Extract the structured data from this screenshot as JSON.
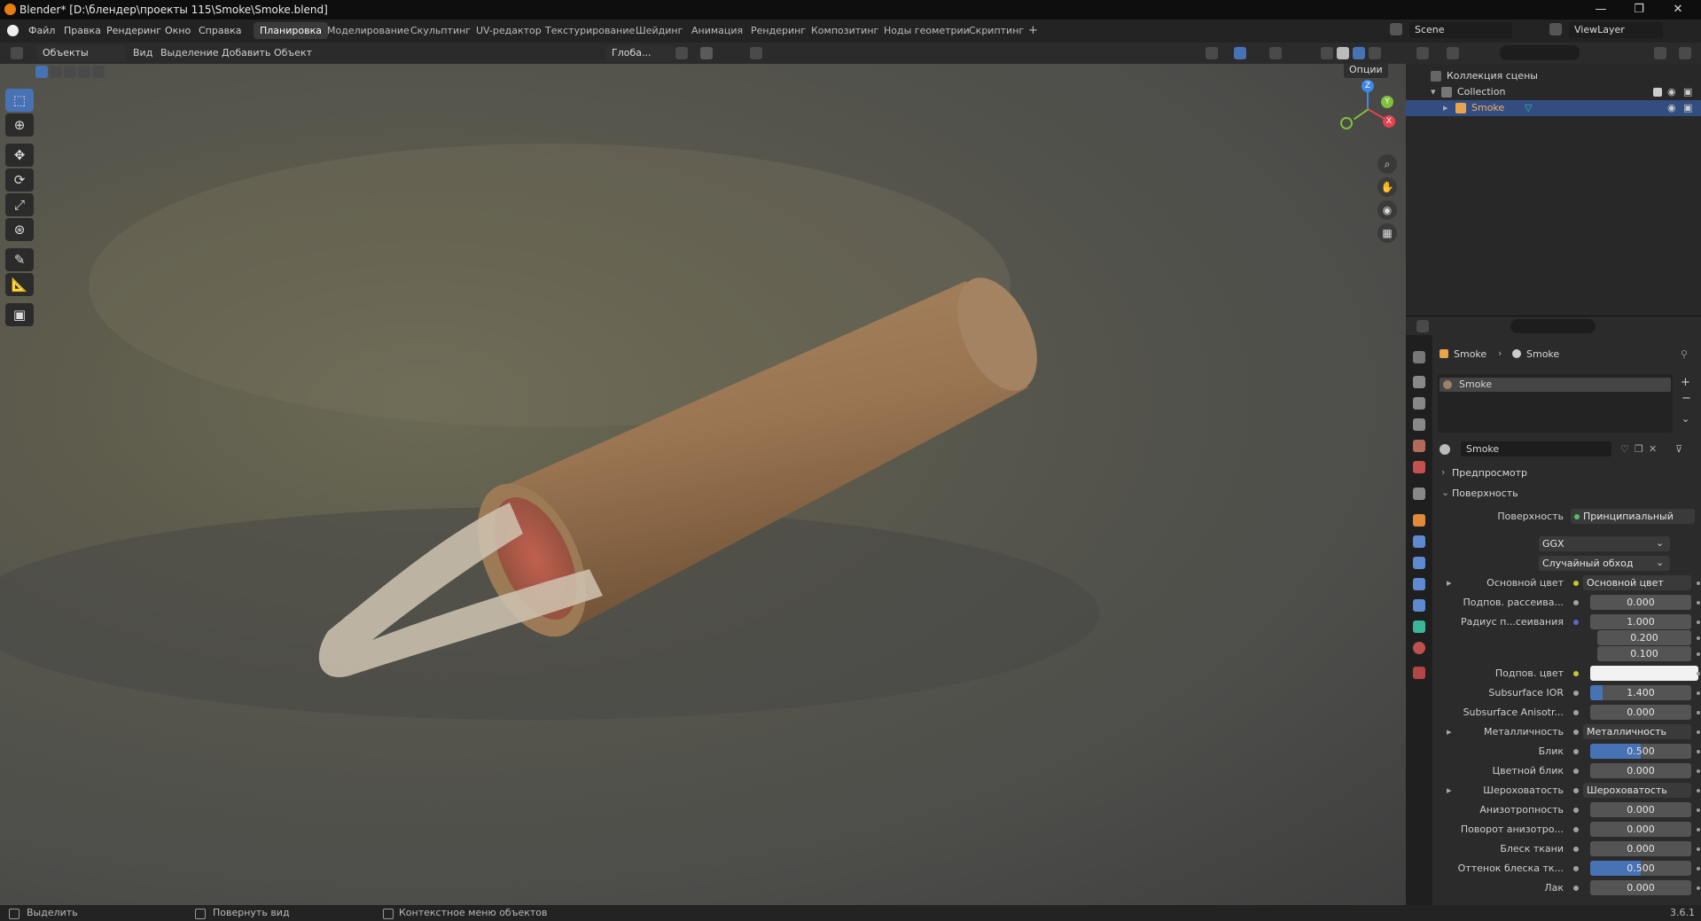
{
  "window": {
    "title": "Blender* [D:\\блендер\\проекты 115\\Smoke\\Smoke.blend]",
    "min": "—",
    "max": "❐",
    "close": "✕"
  },
  "menu": [
    "Файл",
    "Правка",
    "Рендеринг",
    "Окно",
    "Справка"
  ],
  "workspaces": [
    "Планировка",
    "Моделирование",
    "Скульптинг",
    "UV-редактор",
    "Текстурирование",
    "Шейдинг",
    "Анимация",
    "Рендеринг",
    "Композитинг",
    "Ноды геометрии",
    "Скриптинг"
  ],
  "workspace_add": "+",
  "scene": {
    "name": "Scene",
    "view_layer": "ViewLayer"
  },
  "viewport_header": {
    "mode": "Объекты",
    "menus": [
      "Вид",
      "Выделение",
      "Добавить",
      "Объект"
    ],
    "transform": "Глоба...",
    "options": "Опции"
  },
  "outliner": {
    "scene_collection": "Коллекция сцены",
    "collection": "Collection",
    "object": "Smoke"
  },
  "properties": {
    "breadcrumb_object": "Smoke",
    "breadcrumb_material": "Smoke",
    "slot": "Smoke",
    "material_name": "Smoke",
    "sections": {
      "preview": "Предпросмотр",
      "surface": "Поверхность"
    },
    "surface_label": "Поверхность",
    "surface_value": "Принципиальный BSDF",
    "distribution": "GGX",
    "subsurface_method": "Случайный обход",
    "rows": [
      {
        "label": "Основной цвет",
        "value": "Основной цвет",
        "kind": "link",
        "dot": "#c7c729",
        "expand": true
      },
      {
        "label": "Подпов. рассеива...",
        "value": "0.000",
        "kind": "num",
        "dot": "#a1a1a1",
        "fill": 0
      },
      {
        "label": "Радиус п...сеивания",
        "value": "1.000",
        "kind": "num",
        "dot": "#6363c7",
        "fill": 0
      },
      {
        "label": "",
        "value": "0.200",
        "kind": "num",
        "fill": 0
      },
      {
        "label": "",
        "value": "0.100",
        "kind": "num",
        "fill": 0
      },
      {
        "label": "Подпов. цвет",
        "value": "",
        "kind": "color",
        "dot": "#c7c729"
      },
      {
        "label": "Subsurface IOR",
        "value": "1.400",
        "kind": "num",
        "dot": "#a1a1a1",
        "fill": 0.12
      },
      {
        "label": "Subsurface Anisotr...",
        "value": "0.000",
        "kind": "num",
        "dot": "#a1a1a1",
        "fill": 0
      },
      {
        "label": "Металличность",
        "value": "Металличность",
        "kind": "link",
        "dot": "#a1a1a1",
        "expand": true
      },
      {
        "label": "Блик",
        "value": "0.500",
        "kind": "num",
        "dot": "#a1a1a1",
        "fill": 0.5
      },
      {
        "label": "Цветной блик",
        "value": "0.000",
        "kind": "num",
        "dot": "#a1a1a1",
        "fill": 0
      },
      {
        "label": "Шероховатость",
        "value": "Шероховатость",
        "kind": "link",
        "dot": "#a1a1a1",
        "expand": true
      },
      {
        "label": "Анизотропность",
        "value": "0.000",
        "kind": "num",
        "dot": "#a1a1a1",
        "fill": 0
      },
      {
        "label": "Поворот анизотро...",
        "value": "0.000",
        "kind": "num",
        "dot": "#a1a1a1",
        "fill": 0
      },
      {
        "label": "Блеск ткани",
        "value": "0.000",
        "kind": "num",
        "dot": "#a1a1a1",
        "fill": 0
      },
      {
        "label": "Оттенок блеска тк...",
        "value": "0.500",
        "kind": "num",
        "dot": "#a1a1a1",
        "fill": 0.5
      },
      {
        "label": "Лак",
        "value": "0.000",
        "kind": "num",
        "dot": "#a1a1a1",
        "fill": 0
      }
    ]
  },
  "statusbar": {
    "select": "Выделить",
    "rotate": "Повернуть вид",
    "context": "Контекстное меню объектов",
    "version": "3.6.1"
  },
  "gizmo": {
    "x": "X",
    "y": "Y",
    "z": "Z"
  },
  "colors": {
    "accent": "#4772b3",
    "selection": "#334d80",
    "x_axis": "#e8414f",
    "y_axis": "#7fc13a",
    "z_axis": "#3f87e8"
  }
}
